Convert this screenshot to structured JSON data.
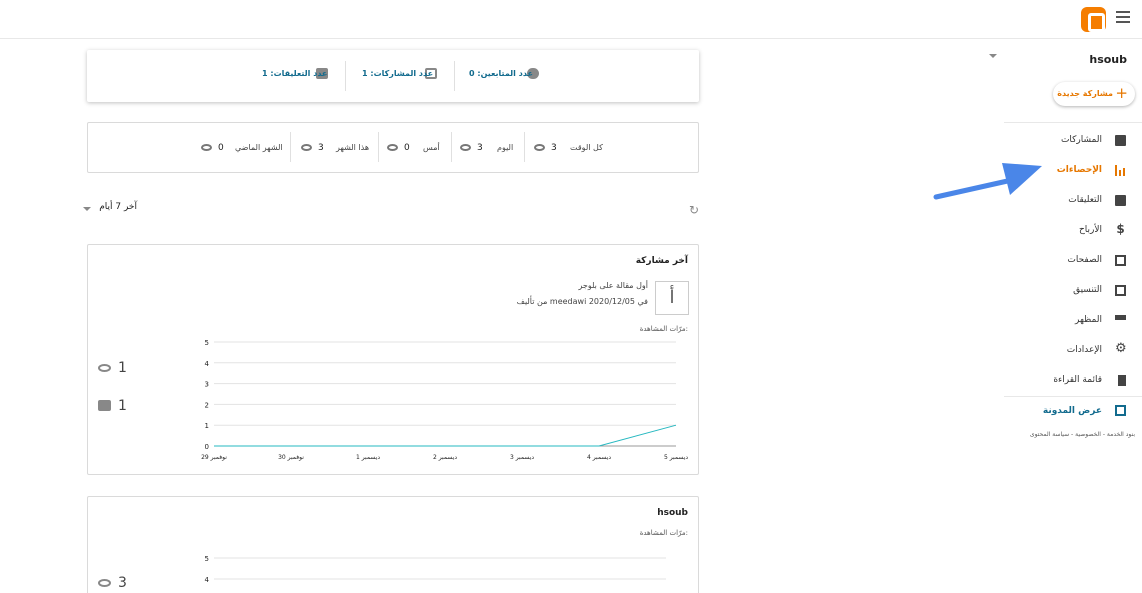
{
  "header": {
    "menu_icon": "hamburger-icon",
    "logo_icon": "blogger-logo-icon"
  },
  "sidebar": {
    "blog_name": "hsoub",
    "new_post_label": "مشاركة جديدة",
    "items": [
      {
        "label": "المشاركات",
        "icon": "posts-icon"
      },
      {
        "label": "الإحصاءات",
        "icon": "stats-icon",
        "active": true
      },
      {
        "label": "التعليقات",
        "icon": "comments-icon"
      },
      {
        "label": "الأرباح",
        "icon": "dollar-icon"
      },
      {
        "label": "الصفحات",
        "icon": "pages-icon"
      },
      {
        "label": "التنسيق",
        "icon": "layout-icon"
      },
      {
        "label": "المظهر",
        "icon": "theme-icon"
      },
      {
        "label": "الإعدادات",
        "icon": "gear-icon"
      },
      {
        "label": "قائمة القراءة",
        "icon": "bookmark-icon"
      }
    ],
    "view_blog_label": "عرض المدونة",
    "footer": "بنود الخدمة - الخصوصية - سياسة المحتوى"
  },
  "summary": {
    "followers": "عدد المتابعين: 0",
    "posts": "عدد المشاركات: 1",
    "comments": "عدد التعليقات: 1"
  },
  "periods": [
    {
      "label": "كل الوقت",
      "value": "3"
    },
    {
      "label": "اليوم",
      "value": "3"
    },
    {
      "label": "أمس",
      "value": "0"
    },
    {
      "label": "هذا الشهر",
      "value": "3"
    },
    {
      "label": "الشهر الماضي",
      "value": "0"
    }
  ],
  "range": {
    "label": "آخر 7 أيام"
  },
  "latest_post": {
    "card_title": "آخر مشاركة",
    "thumb_letter": "أ",
    "title": "أول مقالة على بلوجر",
    "meta": "من تأليف meedawi في 2020/12/05",
    "views_label": "مرّات المشاهدة:",
    "views": "1",
    "comments": "1"
  },
  "blog_stats": {
    "card_title": "hsoub",
    "views_label": "مرّات المشاهدة:",
    "views": "3"
  },
  "chart_data": [
    {
      "type": "line",
      "categories": [
        "نوفمبر 29",
        "نوفمبر 30",
        "ديسمبر 1",
        "ديسمبر 2",
        "ديسمبر 3",
        "ديسمبر 4",
        "ديسمبر 5"
      ],
      "values": [
        0,
        0,
        0,
        0,
        0,
        0,
        1
      ],
      "ylim": [
        0,
        5
      ],
      "yticks": [
        0,
        1,
        2,
        3,
        4,
        5
      ],
      "grid": true,
      "color": "#26b8c0"
    },
    {
      "type": "line",
      "yticks": [
        4,
        5
      ],
      "grid": true
    }
  ]
}
